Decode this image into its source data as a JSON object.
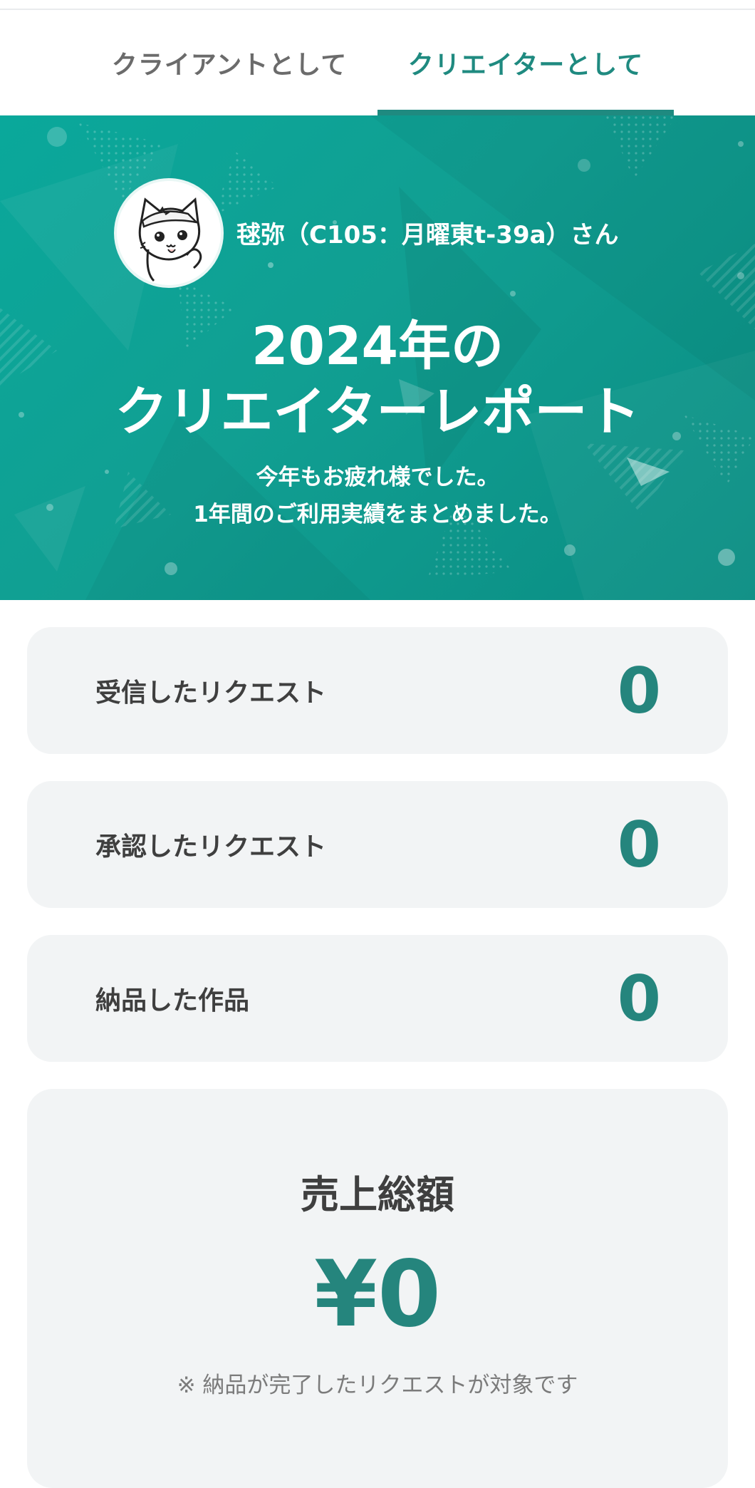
{
  "tabs": [
    {
      "label": "クライアントとして",
      "active": false
    },
    {
      "label": "クリエイターとして",
      "active": true
    }
  ],
  "hero": {
    "user_name": "毬弥（C105：月曜東t-39a）さん",
    "title_line1": "2024年の",
    "title_line2": "クリエイターレポート",
    "subtitle_line1": "今年もお疲れ様でした。",
    "subtitle_line2": "1年間のご利用実績をまとめました。",
    "avatar_icon": "cat-avatar-icon"
  },
  "stats": [
    {
      "label": "受信したリクエスト",
      "value": "0"
    },
    {
      "label": "承認したリクエスト",
      "value": "0"
    },
    {
      "label": "納品した作品",
      "value": "0"
    }
  ],
  "sales": {
    "title": "売上総額",
    "value": "¥0",
    "note": "※ 納品が完了したリクエストが対象です"
  },
  "colors": {
    "accent": "#1f8a80",
    "hero_bg": "#0aa89b",
    "card_bg": "#f2f4f5",
    "value_color": "#25857d"
  }
}
